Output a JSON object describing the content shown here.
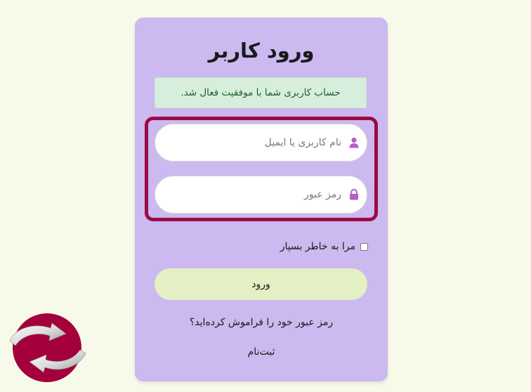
{
  "login": {
    "title": "ورود کاربر",
    "alert_message": "حساب کاربری شما با موفقیت فعال شد.",
    "username_placeholder": "نام کاربری یا ایمیل",
    "password_placeholder": "رمز عبور",
    "remember_label": "مرا به خاطر بسپار",
    "remember_checked": false,
    "submit_label": "ورود",
    "forgot_link": "رمز عبور خود را فراموش کرده‌اید؟",
    "register_link": "ثبت‌نام"
  },
  "icons": {
    "username": "user-icon",
    "password": "lock-icon",
    "logo": "sync-arrows-logo"
  },
  "colors": {
    "page_background": "#f8fae9",
    "card_background": "#cbb9f0",
    "alert_background": "#d7eedc",
    "alert_text": "#1f5e2e",
    "highlight_border": "#9c0a45",
    "submit_background": "#e3f0c4",
    "icon_color": "#b35fc5",
    "logo_red": "#a3003c"
  }
}
